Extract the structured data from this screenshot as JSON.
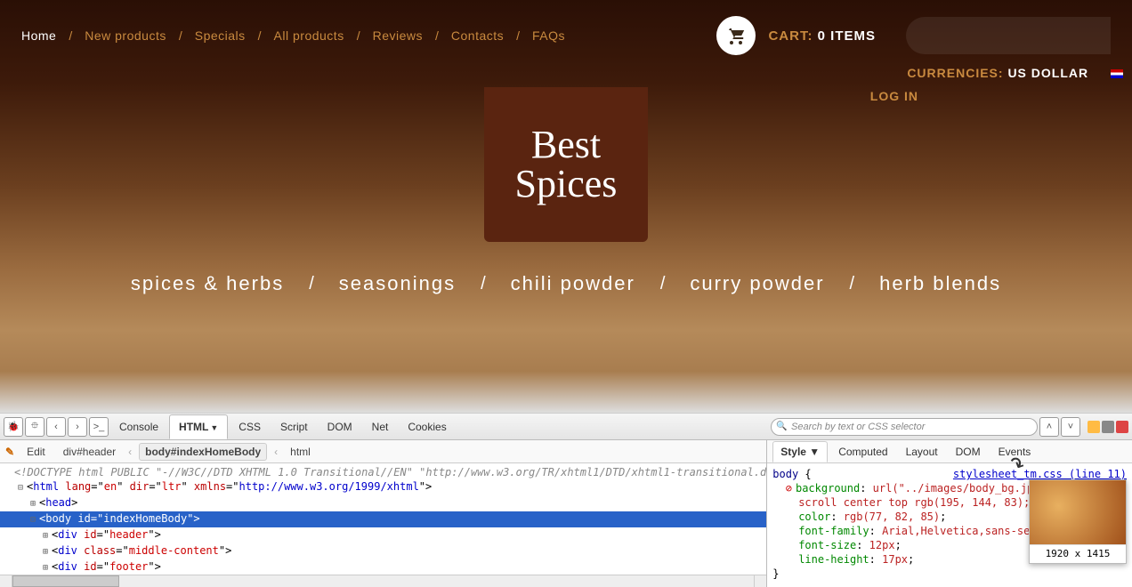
{
  "nav": {
    "items": [
      "Home",
      "New products",
      "Specials",
      "All products",
      "Reviews",
      "Contacts",
      "FAQs"
    ],
    "active_index": 0
  },
  "cart": {
    "label": "CART:",
    "count_text": "0 ITEMS"
  },
  "currencies": {
    "label": "CURRENCIES:",
    "value": "US DOLLAR"
  },
  "login": "LOG IN",
  "logo": {
    "line1": "Best",
    "line2": "Spices"
  },
  "categories": [
    "spices & herbs",
    "seasonings",
    "chili powder",
    "curry powder",
    "herb blends"
  ],
  "devtools": {
    "main_tabs": [
      "Console",
      "HTML",
      "CSS",
      "Script",
      "DOM",
      "Net",
      "Cookies"
    ],
    "main_active": "HTML",
    "search_placeholder": "Search by text or CSS selector",
    "breadcrumb": {
      "edit": "Edit",
      "items": [
        "div#header",
        "body#indexHomeBody",
        "html"
      ],
      "selected": "body#indexHomeBody"
    },
    "html_lines": {
      "doctype": "<!DOCTYPE html PUBLIC \"-//W3C//DTD XHTML 1.0 Transitional//EN\" \"http://www.w3.org/TR/xhtml1/DTD/xhtml1-transitional.d",
      "html_open": {
        "lang": "en",
        "dir": "ltr",
        "xmlns": "http://www.w3.org/1999/xhtml"
      },
      "head": "<head>",
      "body_open": {
        "id": "indexHomeBody"
      },
      "children": [
        {
          "tag": "div",
          "attr": "id",
          "val": "header"
        },
        {
          "tag": "div",
          "attr": "class",
          "val": "middle-content"
        },
        {
          "tag": "div",
          "attr": "id",
          "val": "footer"
        }
      ]
    },
    "right_tabs": [
      "Style",
      "Computed",
      "Layout",
      "DOM",
      "Events"
    ],
    "right_active": "Style",
    "css": {
      "source": "stylesheet_tm.css (line 11)",
      "selector": "body",
      "rules": [
        {
          "prop": "background",
          "val": "url(\"../images/body_bg.jpg\") scroll center top rgb(195, 144, 83)",
          "disabled": true,
          "multiline_tail": "scroll center top rgb(195, 144, 83);"
        },
        {
          "prop": "color",
          "val": "rgb(77, 82, 85)"
        },
        {
          "prop": "font-family",
          "val": "Arial,Helvetica,sans-seri"
        },
        {
          "prop": "font-size",
          "val": "12px"
        },
        {
          "prop": "line-height",
          "val": "17px"
        }
      ],
      "close": "}"
    },
    "preview_dim": "1920 x 1415"
  }
}
